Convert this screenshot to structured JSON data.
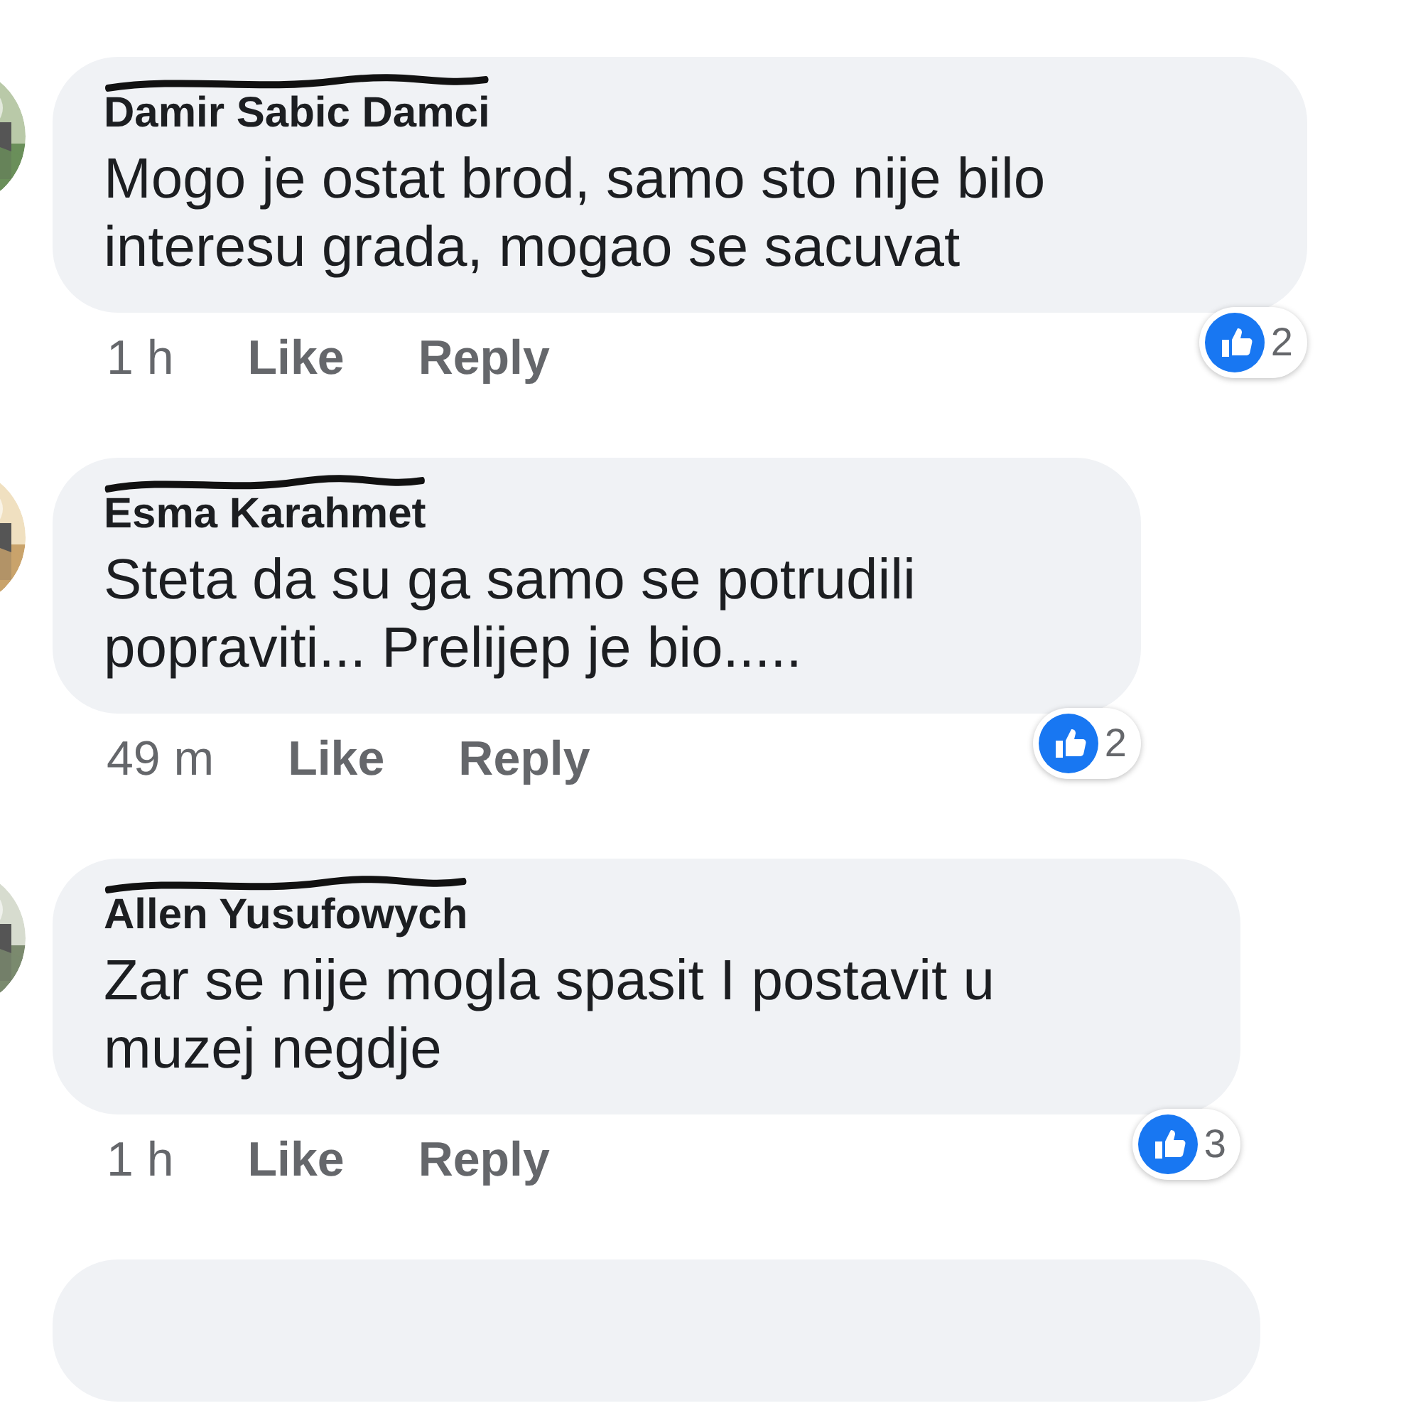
{
  "comments": [
    {
      "name": "Damir Sabic Damci",
      "text": "Mogo je ostat brod, samo sto nije bilo interesu grada, mogao se sacuvat",
      "time": "1 h",
      "actions": [
        "Like",
        "Reply"
      ],
      "reactions": "2"
    },
    {
      "name": "Esma Karahmet",
      "text": "Steta da su ga samo se potrudili popraviti... Prelijep je bio.....",
      "time": "49 m",
      "actions": [
        "Like",
        "Reply"
      ],
      "reactions": "2"
    },
    {
      "name": "Allen Yusufowych",
      "text": "Zar se nije mogla spasit I postavit u muzej negdje",
      "time": "1 h",
      "actions": [
        "Like",
        "Reply"
      ],
      "reactions": "3"
    }
  ]
}
